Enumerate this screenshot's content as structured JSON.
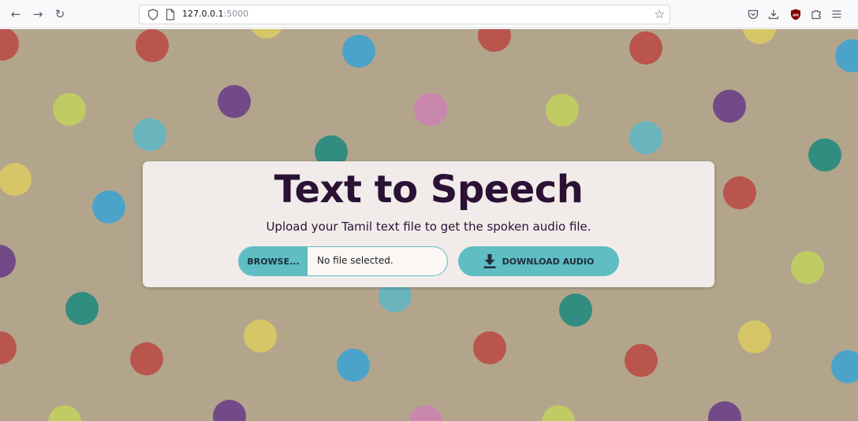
{
  "browser": {
    "url_host": "127.0.0.1",
    "url_port": ":5000",
    "icons": [
      "back-arrow-icon",
      "forward-arrow-icon",
      "reload-icon",
      "tracking-shield-icon",
      "page-icon",
      "bookmark-star-icon",
      "pocket-icon",
      "downloads-icon",
      "ublock-extension-icon",
      "extensions-icon",
      "menu-icon"
    ]
  },
  "main": {
    "title": "Text to Speech",
    "subtitle": "Upload your Tamil text file to get the spoken audio file.",
    "browse_label": "BROWSE...",
    "file_status": "No file selected.",
    "download_label": "DOWNLOAD AUDIO"
  },
  "colors": {
    "accent": "#5fbdc4",
    "title_color": "#2b1235",
    "card_bg": "#f1ecea",
    "page_bg": "#b2a58c"
  }
}
